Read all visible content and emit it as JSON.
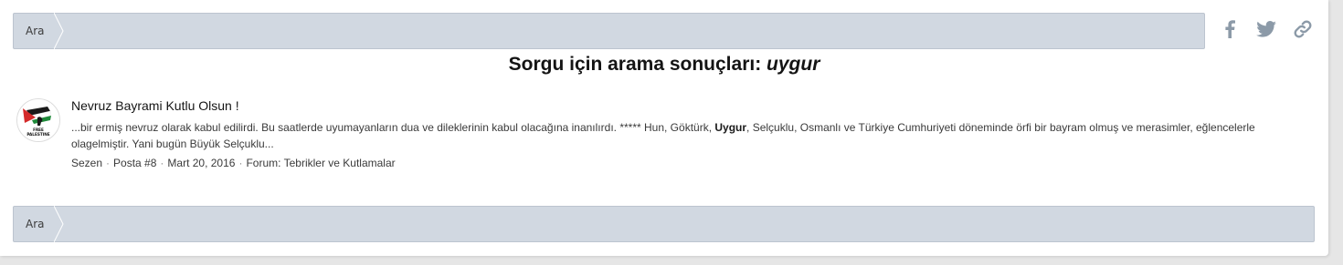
{
  "breadcrumb_top": {
    "label": "Ara"
  },
  "breadcrumb_bottom": {
    "label": "Ara"
  },
  "share": {
    "icons": [
      "facebook-icon",
      "twitter-icon",
      "link-icon"
    ],
    "color": "#8c9aa8"
  },
  "search": {
    "title_prefix": "Sorgu için arama sonuçları:",
    "query": "uygur"
  },
  "result": {
    "title": "Nevruz Bayrami Kutlu Olsun !",
    "snippet_before": "...bir ermiş nevruz olarak kabul edilirdi. Bu saatlerde uyumayanların dua ve dileklerinin kabul olacağına inanılırdı. ***** Hun, Göktürk, ",
    "snippet_highlight": "Uygur",
    "snippet_after": ", Selçuklu, Osmanlı ve Türkiye Cumhuriyeti döneminde örfi bir bayram olmuş ve merasimler, eğlencelerle olagelmiştir. Yani bugün Büyük Selçuklu...",
    "author": "Sezen",
    "post": "Posta #8",
    "date": "Mart 20, 2016",
    "forum_prefix": "Forum:",
    "forum": "Tebrikler ve Kutlamalar",
    "avatar_text": "FREE PALESTINE"
  },
  "colors": {
    "breadcrumb_bg": "#d1d8e1",
    "page_bg": "#ffffff",
    "outer_bg": "#e6e6e6"
  }
}
